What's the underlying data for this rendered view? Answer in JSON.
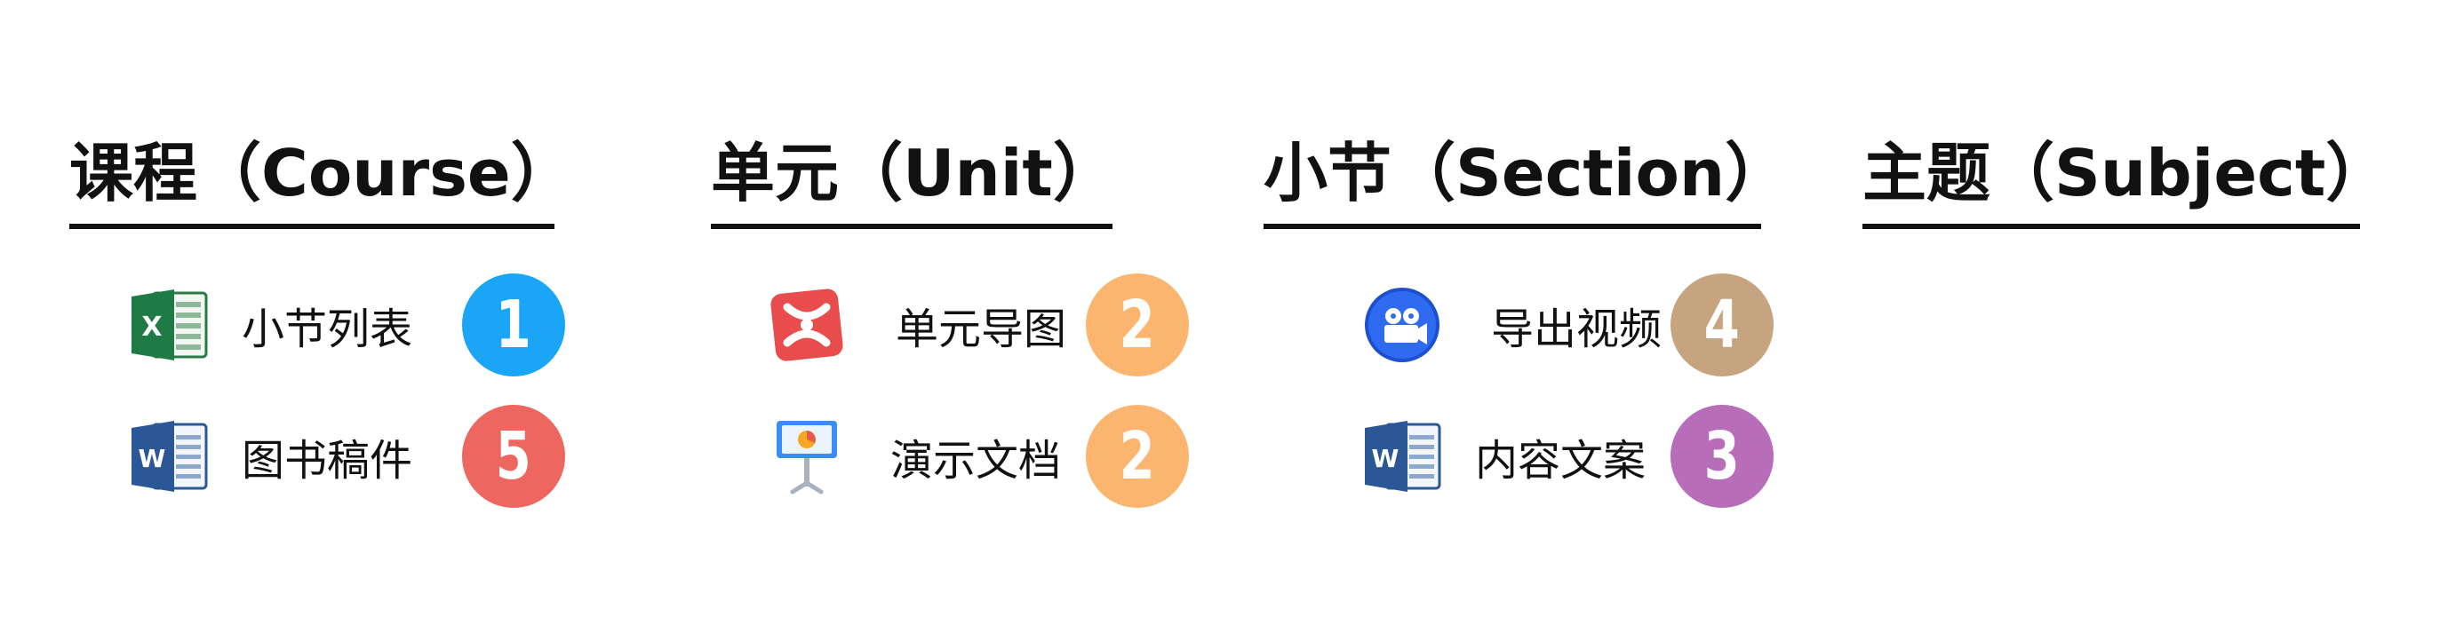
{
  "columns": [
    {
      "title": "课程（Course）",
      "items": [
        {
          "icon": "excel-icon",
          "label": "小节列表",
          "count": "1",
          "badge_color": "#1BA5F7"
        },
        {
          "icon": "word-icon",
          "label": "图书稿件",
          "count": "5",
          "badge_color": "#EE6660"
        }
      ]
    },
    {
      "title": "单元（Unit）",
      "items": [
        {
          "icon": "xmind-icon",
          "label": "单元导图",
          "count": "2",
          "badge_color": "#FBB56F"
        },
        {
          "icon": "keynote-icon",
          "label": "演示文档",
          "count": "2",
          "badge_color": "#FBB56F"
        }
      ]
    },
    {
      "title": "小节（Section）",
      "items": [
        {
          "icon": "video-camera-icon",
          "label": "导出视频",
          "count": "4",
          "badge_color": "#C5A47F"
        },
        {
          "icon": "word-icon",
          "label": "内容文案",
          "count": "3",
          "badge_color": "#B76DB7"
        }
      ]
    },
    {
      "title": "主题（Subject）",
      "items": []
    }
  ]
}
